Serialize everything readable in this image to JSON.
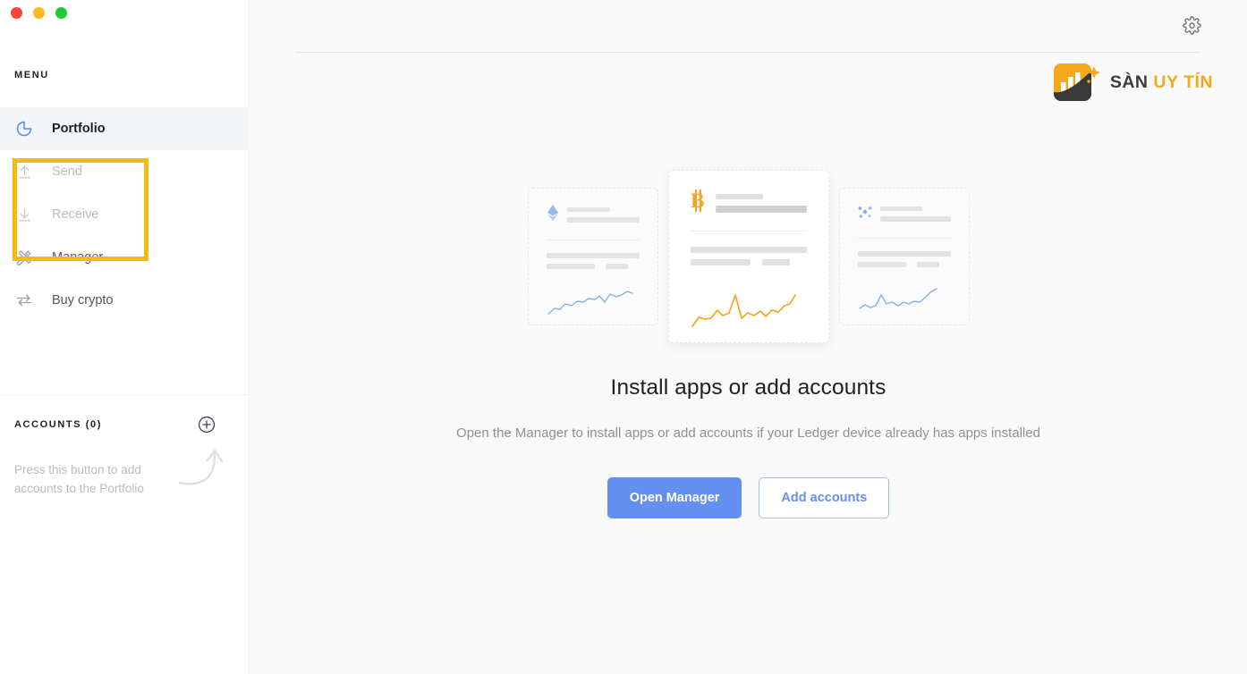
{
  "window": {
    "controls": [
      {
        "name": "close",
        "color": "#f7453c"
      },
      {
        "name": "minimize",
        "color": "#fcbb1d"
      },
      {
        "name": "maximize",
        "color": "#1ecb35"
      }
    ]
  },
  "sidebar": {
    "menu_label": "MENU",
    "items": [
      {
        "label": "Portfolio",
        "icon": "pie-chart-icon",
        "state": "active"
      },
      {
        "label": "Send",
        "icon": "upload-arrow-icon",
        "state": "disabled"
      },
      {
        "label": "Receive",
        "icon": "download-arrow-icon",
        "state": "disabled"
      },
      {
        "label": "Manager",
        "icon": "wrench-screwdriver-icon",
        "state": "normal"
      },
      {
        "label": "Buy crypto",
        "icon": "exchange-arrows-icon",
        "state": "normal"
      }
    ],
    "highlight": {
      "covers": [
        "Send",
        "Receive"
      ],
      "color": "#f5b914"
    },
    "accounts": {
      "label": "ACCOUNTS (0)",
      "count": 0,
      "add_icon": "plus-circle-icon",
      "hint": "Press this button to add accounts to the Portfolio",
      "arrow_icon": "curved-arrow-icon"
    }
  },
  "header": {
    "settings_icon": "gear-icon",
    "brand": {
      "logo_icon": "bar-chart-logo-icon",
      "text_primary": "SÀN",
      "text_accent": "UY TÍN",
      "color_dark": "#3a3a3a",
      "color_accent": "#f5a81c"
    }
  },
  "main": {
    "cards": [
      {
        "coin": "ethereum",
        "icon": "ethereum-icon",
        "icon_color": "#7f9fe8",
        "spark_color": "#7fa9e8",
        "position": "left"
      },
      {
        "coin": "bitcoin",
        "icon": "bitcoin-icon",
        "icon_color": "#f5a623",
        "spark_color": "#f5a623",
        "position": "center"
      },
      {
        "coin": "cosmos",
        "icon": "cosmos-atom-icon",
        "icon_color": "#7f9fe8",
        "spark_color": "#7fa9e8",
        "position": "right"
      }
    ],
    "empty_state": {
      "title": "Install apps or add accounts",
      "description": "Open the Manager to install apps or add accounts if your Ledger device already has apps installed",
      "primary_button": "Open Manager",
      "secondary_button": "Add accounts",
      "primary_color": "#6490f1"
    }
  }
}
